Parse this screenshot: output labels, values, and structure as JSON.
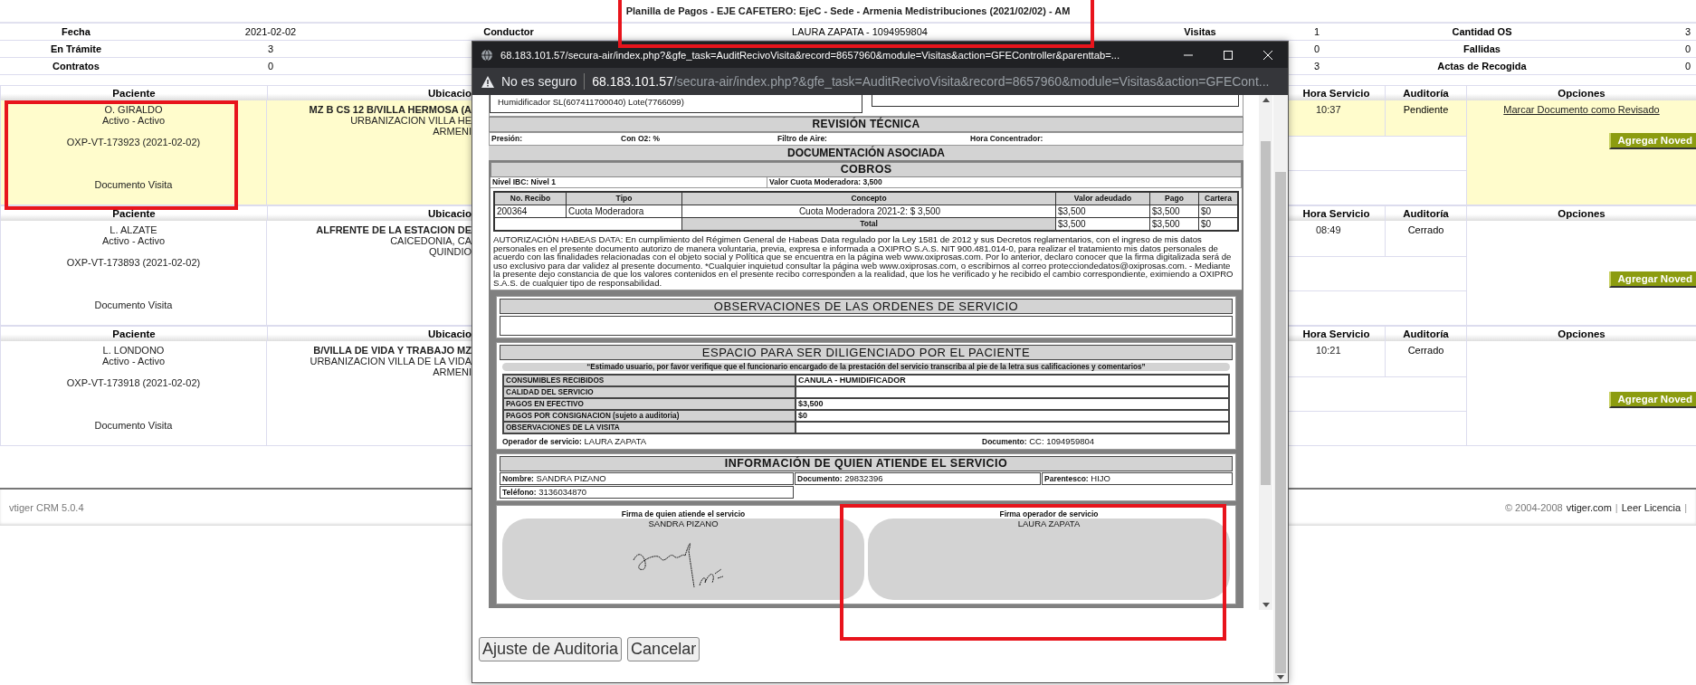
{
  "report": {
    "title": "Planilla de Pagos - EJE CAFETERO: EjeC - Sede - Armenia Medistribuciones (2021/02/02) - AM",
    "marked": true,
    "summary": [
      {
        "column_1": {
          "label": "Fecha",
          "value": "2021-02-02"
        },
        "column_2": {
          "label": "Conductor",
          "value": "LAURA ZAPATA - 1094959804"
        },
        "column_3": {
          "label": "Visitas",
          "value": "1"
        },
        "column_4": {
          "label": "Cantidad OS",
          "value": "3"
        }
      },
      {
        "column_1": {
          "label": "En Trámite",
          "value": "3"
        },
        "column_3": {
          "value": "0"
        },
        "column_4": {
          "label": "Fallidas",
          "value": "0"
        }
      },
      {
        "column_1": {
          "label": "Contratos",
          "value": "0"
        },
        "column_3": {
          "value": "3"
        },
        "column_4": {
          "label": "Actas de Recogida",
          "value": "0"
        }
      }
    ]
  },
  "visits": [
    {
      "highlighted": true,
      "marked": true,
      "headers": [
        "Paciente",
        "Ubicacio",
        "Hora Servicio",
        "Auditoría",
        "Opciones"
      ],
      "patient": "O. GIRALDO",
      "status": "Activo - Activo",
      "order": "OXP-VT-173923 (2021-02-02)",
      "document": "Documento Visita",
      "address": [
        "MZ B CS 12 B/VILLA HERMOSA (A",
        "URBANIZACION VILLA HE",
        "ARMENI"
      ],
      "time": "10:37",
      "audit": "Pendiente",
      "review_link": "Marcar Documento como Revisado",
      "add_button": "Agregar Noved"
    },
    {
      "highlighted": false,
      "marked": false,
      "headers": [
        "Paciente",
        "Ubicacio",
        "Hora Servicio",
        "Auditoría",
        "Opciones"
      ],
      "patient": "L. ALZATE",
      "status": "Activo - Activo",
      "order": "OXP-VT-173893 (2021-02-02)",
      "document": "Documento Visita",
      "address": [
        "ALFRENTE DE LA ESTACION DE",
        "CAICEDONIA, CA",
        "QUINDIO"
      ],
      "time": "08:49",
      "audit": "Cerrado",
      "add_button": "Agregar Noved"
    },
    {
      "highlighted": false,
      "marked": false,
      "headers": [
        "Paciente",
        "Ubicacio",
        "Hora Servicio",
        "Auditoría",
        "Opciones"
      ],
      "patient": "L. LONDONO",
      "status": "Activo - Activo",
      "order": "OXP-VT-173918 (2021-02-02)",
      "document": "Documento Visita",
      "address": [
        "B/VILLA DE VIDA Y TRABAJO MZ",
        "URBANIZACION VILLA DE LA VIDA",
        "ARMENI"
      ],
      "time": "10:21",
      "audit": "Cerrado",
      "add_button": "Agregar Noved"
    }
  ],
  "footer": {
    "product": "vtiger CRM 5.0.4",
    "parts": [
      {
        "kind": "text",
        "text": "© 2004-2008"
      },
      {
        "kind": "link",
        "text": "vtiger.com"
      },
      {
        "kind": "sep",
        "text": "|"
      },
      {
        "kind": "link",
        "text": "Leer Licencia"
      },
      {
        "kind": "sep",
        "text": "|"
      }
    ]
  },
  "popup": {
    "window_title": "68.183.101.57/secura-air/index.php?&gfe_task=AuditRecivoVisita&record=8657960&module=Visitas&action=GFEController&parenttab=...",
    "security": "No es seguro",
    "url_host": "68.183.101.57",
    "url_path": "/secura-air/index.php?&gfe_task=AuditRecivoVisita&record=8657960&module=Visitas&action=GFECont...",
    "document": {
      "equipment_line": "Humidificador SL(607411700040) Lote(7766099)",
      "technical": {
        "title": "REVISIÓN TÉCNICA",
        "fields": [
          "Presión:",
          "Con O2: %",
          "Filtro de Aire:",
          "Hora Concentrador:"
        ]
      },
      "docs_title": "DOCUMENTACIÓN ASOCIADA",
      "charges": {
        "title": "COBROS",
        "level": "Nivel IBC: Nivel 1",
        "fee": "Valor Cuota Moderadora: 3,500",
        "columns": [
          "No. Recibo",
          "Tipo",
          "Concepto",
          "Valor adeudado",
          "Pago",
          "Cartera"
        ],
        "rows": [
          [
            "200364",
            "Cuota Moderadora",
            "Cuota Moderadora 2021-2: $ 3,500",
            "$3,500",
            "$3,500",
            "$0"
          ]
        ],
        "total": {
          "label": "Total",
          "values": [
            "$3,500",
            "$3,500",
            "$0"
          ]
        }
      },
      "consent": "AUTORIZACIÓN HABEAS DATA: En cumplimiento del Régimen General de Habeas Data regulado por la Ley 1581 de 2012 y sus Decretos reglamentarios, con el ingreso de mis datos personales en el presente documento autorizo de manera voluntaria, previa, expresa e informada a OXIPRO S.A.S. NIT 900.481.014-0, para realizar el tratamiento mis datos personales de acuerdo con las finalidades relacionadas con el objeto social y Política que se encuentra en la página web www.oxiprosas.com. Por lo anterior, declaro conocer que la firma digitalizada será de uso exclusivo para dar validez al presente documento. *Cualquier inquietud consultar la página web www.oxiprosas.com, o escribirnos al correo protecciondedatos@oxiprosas.com. - Mediante la presente dejo constancia de que los valores contenidos en el presente recibo corresponden a la realidad, que los he verificado y he recibido el cambio correspondiente, eximiendo a OXIPRO S.A.S. de cualquier tipo de responsabilidad.",
      "observations_title": "OBSERVACIONES DE LAS ORDENES DE SERVICIO",
      "patient_space": {
        "title": "ESPACIO PARA SER DILIGENCIADO POR EL PACIENTE",
        "note": "“Estimado usuario, por favor verifique que el funcionario encargado de la prestación del servicio transcriba al pie de la letra sus calificaciones y comentarios”",
        "rows": [
          {
            "label": "CONSUMIBLES RECIBIDOS",
            "value": "CANULA - HUMIDIFICADOR"
          },
          {
            "label": "CALIDAD DEL SERVICIO"
          },
          {
            "label": "PAGOS EN EFECTIVO",
            "value": "$3,500"
          },
          {
            "label": "PAGOS POR CONSIGNACION (sujeto a auditoria)",
            "value": "$0"
          },
          {
            "label": "OBSERVACIONES DE LA VISITA"
          }
        ],
        "operator": "**Operador de servicio:** LAURA ZAPATA",
        "operator_document": "**Documento:** CC: 1094959804"
      },
      "attendant": {
        "title": "INFORMACIÓN DE QUIEN ATIENDE EL SERVICIO",
        "name": "**Nombre:** SANDRA PIZANO",
        "document": "**Documento:** 29832396",
        "relation": "**Parentesco:** HIJO",
        "phone": "**Teléfono:** 3136034870"
      },
      "signatures": [
        {
          "label": "Firma de quien atiende el servicio",
          "name": "SANDRA PIZANO",
          "signed": true,
          "marked": false
        },
        {
          "label": "Firma operador de servicio",
          "name": "LAURA ZAPATA",
          "signed": false,
          "marked": true
        }
      ]
    },
    "buttons": [
      "Ajuste de Auditoria",
      "Cancelar"
    ]
  }
}
